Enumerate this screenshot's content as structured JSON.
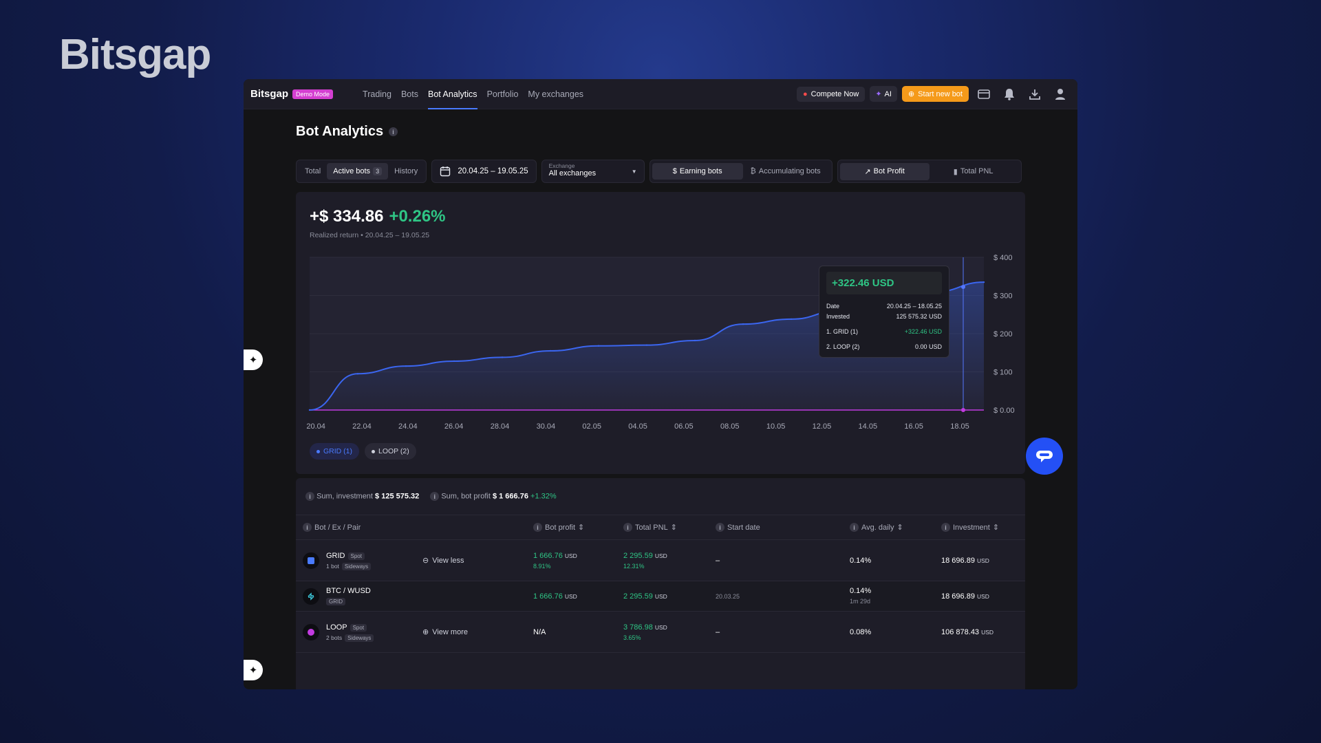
{
  "brand_watermark": "Bitsgap",
  "topbar": {
    "logo": "Bitsgap",
    "demo_badge": "Demo Mode",
    "nav": [
      "Trading",
      "Bots",
      "Bot Analytics",
      "Portfolio",
      "My exchanges"
    ],
    "active_nav": "Bot Analytics",
    "compete_label": "Compete Now",
    "ai_label": "AI",
    "start_bot_label": "Start new bot"
  },
  "page": {
    "title": "Bot Analytics"
  },
  "filters": {
    "scope_tabs": [
      "Total",
      "Active bots",
      "History"
    ],
    "active_bots_count": "3",
    "date_range": "20.04.25 – 19.05.25",
    "exchange_label": "Exchange",
    "exchange_value": "All exchanges",
    "mode_tabs": [
      "Earning bots",
      "Accumulating bots"
    ],
    "view_tabs": [
      "Bot Profit",
      "Total PNL"
    ]
  },
  "summary": {
    "value": "+$ 334.86",
    "percent": "+0.26%",
    "subtitle": "Realized return • 20.04.25 – 19.05.25"
  },
  "chart_data": {
    "type": "area",
    "x": [
      "20.04",
      "22.04",
      "24.04",
      "26.04",
      "28.04",
      "30.04",
      "02.05",
      "04.05",
      "06.05",
      "08.05",
      "10.05",
      "12.05",
      "14.05",
      "16.05",
      "18.05"
    ],
    "series": [
      {
        "name": "GRID (1)",
        "values": [
          0,
          95,
          115,
          128,
          138,
          155,
          168,
          170,
          182,
          225,
          238,
          260,
          285,
          310,
          334.86
        ]
      }
    ],
    "y_ticks": [
      "$ 400",
      "$ 300",
      "$ 200",
      "$ 100",
      "$ 0.00"
    ],
    "ylim": [
      0,
      400
    ],
    "legend": [
      "GRID (1)",
      "LOOP (2)"
    ],
    "line_color": "#3b66f0",
    "accent_green": "#2fc585"
  },
  "tooltip": {
    "value": "+322.46 USD",
    "rows": [
      {
        "label": "Date",
        "value": "20.04.25 – 18.05.25"
      },
      {
        "label": "Invested",
        "value": "125 575.32 USD"
      },
      {
        "label": "1. GRID (1)",
        "value": "+322.46 USD"
      },
      {
        "label": "2. LOOP (2)",
        "value": "0.00 USD"
      }
    ]
  },
  "sums": {
    "investment_label": "Sum, investment",
    "investment_value": "$ 125 575.32",
    "profit_label": "Sum, bot profit",
    "profit_value": "$ 1 666.76",
    "profit_pct": "+1.32%"
  },
  "table": {
    "headers": [
      "Bot / Ex / Pair",
      "Bot profit",
      "Total PNL",
      "Start date",
      "Avg. daily",
      "Investment"
    ],
    "rows": [
      {
        "name": "GRID",
        "tag": "Spot",
        "meta": "1 bot",
        "meta_tag": "Sideways",
        "action": "View less",
        "profit": "1 666.76",
        "profit_unit": "USD",
        "profit_pct": "8.91%",
        "pnl": "2 295.59",
        "pnl_unit": "USD",
        "pnl_pct": "12.31%",
        "start": "–",
        "avg": "0.14%",
        "investment": "18 696.89",
        "inv_unit": "USD"
      },
      {
        "name": "BTC / WUSD",
        "meta_tag": "GRID",
        "profit": "1 666.76",
        "profit_unit": "USD",
        "pnl": "2 295.59",
        "pnl_unit": "USD",
        "start": "20.03.25",
        "avg": "0.14%",
        "avg_sub": "1m 29d",
        "investment": "18 696.89",
        "inv_unit": "USD"
      },
      {
        "name": "LOOP",
        "tag": "Spot",
        "meta": "2 bots",
        "meta_tag": "Sideways",
        "action": "View more",
        "profit": "N/A",
        "pnl": "3 786.98",
        "pnl_unit": "USD",
        "pnl_pct": "3.65%",
        "start": "–",
        "avg": "0.08%",
        "investment": "106 878.43",
        "inv_unit": "USD"
      }
    ]
  }
}
